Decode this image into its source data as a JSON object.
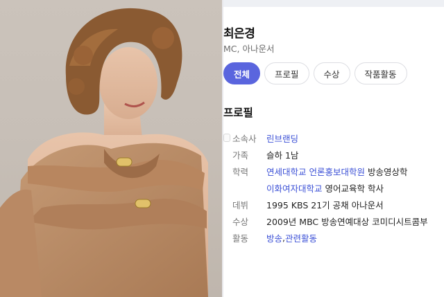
{
  "profile": {
    "name": "최은경",
    "subtitle": "MC, 아나운서"
  },
  "tabs": [
    {
      "label": "전체",
      "active": true
    },
    {
      "label": "프로필",
      "active": false
    },
    {
      "label": "수상",
      "active": false
    },
    {
      "label": "작품활동",
      "active": false
    }
  ],
  "section_title": "프로필",
  "details": {
    "agency": {
      "label": "소속사",
      "value": "린브랜딩"
    },
    "family": {
      "label": "가족",
      "value": "슬하 1남"
    },
    "education": {
      "label": "학력",
      "line1_school": "연세대학교",
      "line1_grad": "언론홍보대학원",
      "line1_major": "방송영상학",
      "line2_school": "이화여자대학교",
      "line2_major": "영어교육학 학사"
    },
    "debut": {
      "label": "데뷔",
      "value": "1995 KBS 21기 공채 아나운서"
    },
    "award": {
      "label": "수상",
      "value": "2009년 MBC 방송연예대상 코미디시트콤부"
    },
    "activity": {
      "label": "활동",
      "link1": "방송",
      "sep": ", ",
      "link2": "관련활동"
    }
  },
  "colors": {
    "accent": "#5a65de",
    "link": "#3a4fd6"
  }
}
